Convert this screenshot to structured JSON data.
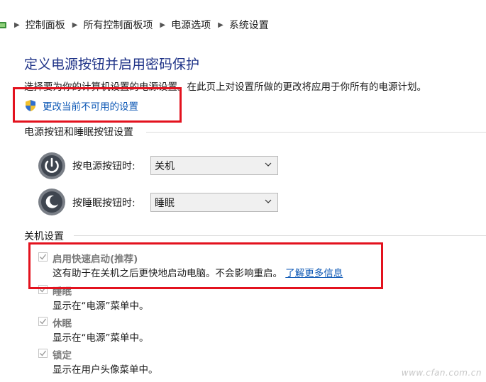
{
  "breadcrumb": {
    "items": [
      "控制面板",
      "所有控制面板项",
      "电源选项",
      "系统设置"
    ]
  },
  "page": {
    "title": "定义电源按钮并启用密码保护",
    "description": "选择要为你的计算机设置的电源设置。在此页上对设置所做的更改将应用于你所有的电源计划。",
    "change_settings_link": "更改当前不可用的设置"
  },
  "power_section": {
    "heading": "电源按钮和睡眠按钮设置",
    "power_button": {
      "label": "按电源按钮时:",
      "value": "关机"
    },
    "sleep_button": {
      "label": "按睡眠按钮时:",
      "value": "睡眠"
    }
  },
  "shutdown_section": {
    "heading": "关机设置",
    "options": [
      {
        "title": "启用快速启动(推荐)",
        "desc": "这有助于在关机之后更快地启动电脑。不会影响重启。",
        "link": "了解更多信息",
        "checked": true
      },
      {
        "title": "睡眠",
        "desc": "显示在“电源”菜单中。",
        "checked": true
      },
      {
        "title": "休眠",
        "desc": "显示在“电源”菜单中。",
        "checked": true
      },
      {
        "title": "锁定",
        "desc": "显示在用户头像菜单中。",
        "checked": true
      }
    ]
  },
  "watermark": "www.cfan.com.cn",
  "colors": {
    "link": "#0a56b4",
    "title": "#1e3287",
    "highlight_box": "#e3121e"
  }
}
